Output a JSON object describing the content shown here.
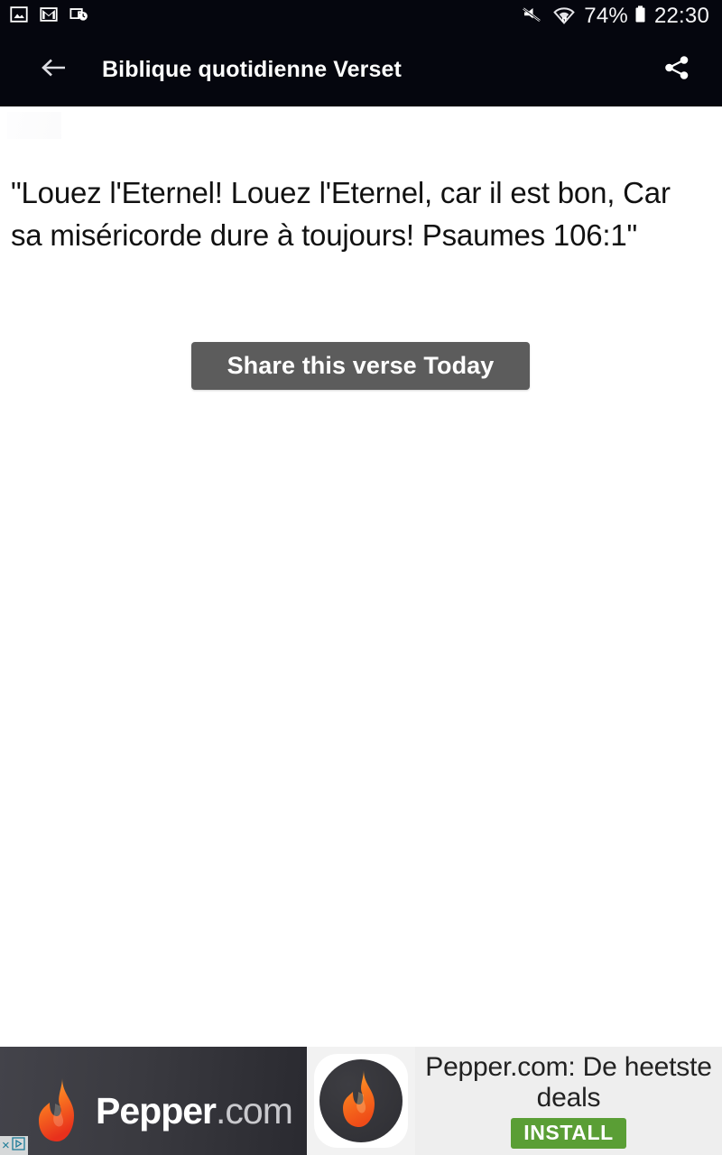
{
  "status_bar": {
    "left_icons": [
      "photo-icon",
      "gmail-icon",
      "screen-record-icon"
    ],
    "right_icons": [
      "mute-icon",
      "wifi-icon"
    ],
    "battery_percent": "74%",
    "time": "22:30",
    "background_color": "#05060e",
    "text_color": "#f4f4f6"
  },
  "title_bar": {
    "back_label": "back-arrow",
    "title": "Biblique quotidienne Verset",
    "share_label": "share",
    "background_color": "#05060e"
  },
  "main": {
    "verse_text": "\"Louez l'Eternel! Louez l'Eternel, car il est bon, Car sa miséricorde dure à toujours! Psaumes 106:1\"",
    "share_button_label": "Share this verse Today",
    "share_button_color": "#5c5c5c",
    "background_color": "#ffffff"
  },
  "ad_banner": {
    "brand_name_bold": "Pepper",
    "brand_name_light": ".com",
    "headline": "Pepper.com: De heetste deals",
    "install_label": "INSTALL",
    "install_color": "#5a9e35",
    "adchoices_close": "×",
    "panel_color": "#eeeeee",
    "brand_panel_color": "#3a3a40"
  }
}
